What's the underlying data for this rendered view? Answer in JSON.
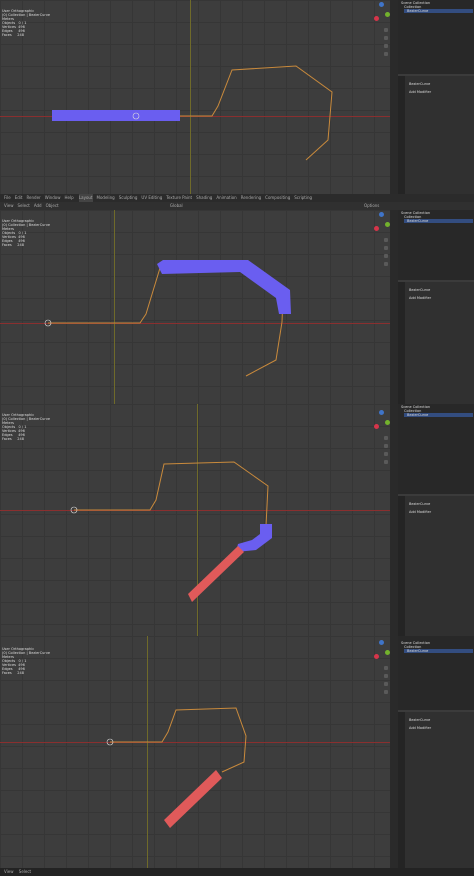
{
  "views": [
    {
      "info": [
        "User Orthographic",
        "(0) Collection | BezierCurve",
        "Meters",
        "",
        "Objects   0 / 1",
        "Vertices  496",
        "Edges     496",
        "Faces     248",
        "Triangles 496"
      ]
    },
    {
      "info": [
        "User Orthographic",
        "(0) Collection | BezierCurve",
        "Meters",
        "",
        "Objects   0 / 1",
        "Vertices  496",
        "Edges     496",
        "Faces     248",
        "Triangles 496"
      ]
    },
    {
      "info": [
        "User Orthographic",
        "(0) Collection | BezierCurve",
        "Meters",
        "",
        "Objects   0 / 1",
        "Vertices  496",
        "Edges     496",
        "Faces     248",
        "Triangles 496"
      ]
    },
    {
      "info": [
        "User Orthographic",
        "(0) Collection | BezierCurve",
        "Meters",
        "",
        "Objects   0 / 1",
        "Vertices  496",
        "Edges     496",
        "Faces     248",
        "Triangles 496"
      ]
    }
  ],
  "menu": {
    "view": "View",
    "select": "Select",
    "add": "Add",
    "object": "Object",
    "options": "Options"
  },
  "workspace_tabs": [
    "Layout",
    "Modeling",
    "Sculpting",
    "UV Editing",
    "Texture Paint",
    "Shading",
    "Animation",
    "Rendering",
    "Compositing",
    "Scripting"
  ],
  "top_menu": [
    "File",
    "Edit",
    "Render",
    "Window",
    "Help"
  ],
  "transform_mode": "Global",
  "outliner": {
    "title": "Scene Collection",
    "collection": "Collection",
    "object": "BezierCurve"
  },
  "properties": {
    "object_name": "BezierCurve",
    "add_modifier": "Add Modifier"
  },
  "colors": {
    "curve": "#c98a3c",
    "blue": "#6a5ef0",
    "red": "#e05a5a",
    "x_axis": "#8a2f2f"
  }
}
